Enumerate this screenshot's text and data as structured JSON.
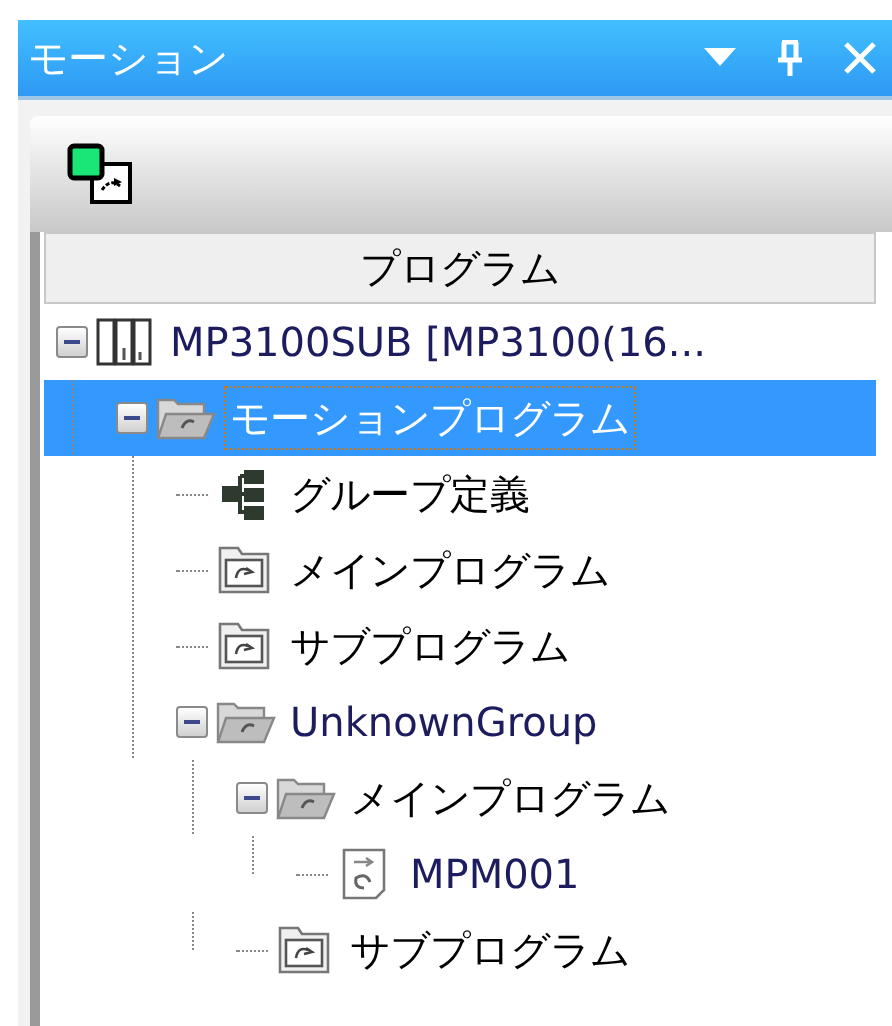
{
  "window": {
    "title": "モーション"
  },
  "tree": {
    "column_header": "プログラム",
    "items": [
      {
        "label": "MP3100SUB [MP3100(16...",
        "kind": "controller",
        "color": "#1c1c5e",
        "expanded": true,
        "selected": false,
        "children": [
          {
            "label": "モーションプログラム",
            "kind": "folder",
            "expanded": true,
            "selected": true,
            "children": [
              {
                "label": "グループ定義",
                "kind": "group",
                "color": "#000000",
                "selected": false
              },
              {
                "label": "メインプログラム",
                "kind": "folder",
                "color": "#000000",
                "selected": false
              },
              {
                "label": "サブプログラム",
                "kind": "folder",
                "color": "#000000",
                "selected": false
              },
              {
                "label": "UnknownGroup",
                "kind": "folder",
                "color": "#1c1c5e",
                "expanded": true,
                "selected": false,
                "children": [
                  {
                    "label": "メインプログラム",
                    "kind": "folder",
                    "color": "#000000",
                    "expanded": true,
                    "selected": false,
                    "children": [
                      {
                        "label": "MPM001",
                        "kind": "program",
                        "color": "#1c1c5e",
                        "selected": false
                      }
                    ]
                  },
                  {
                    "label": "サブプログラム",
                    "kind": "folder",
                    "color": "#000000",
                    "selected": false
                  }
                ]
              }
            ]
          }
        ]
      }
    ]
  }
}
